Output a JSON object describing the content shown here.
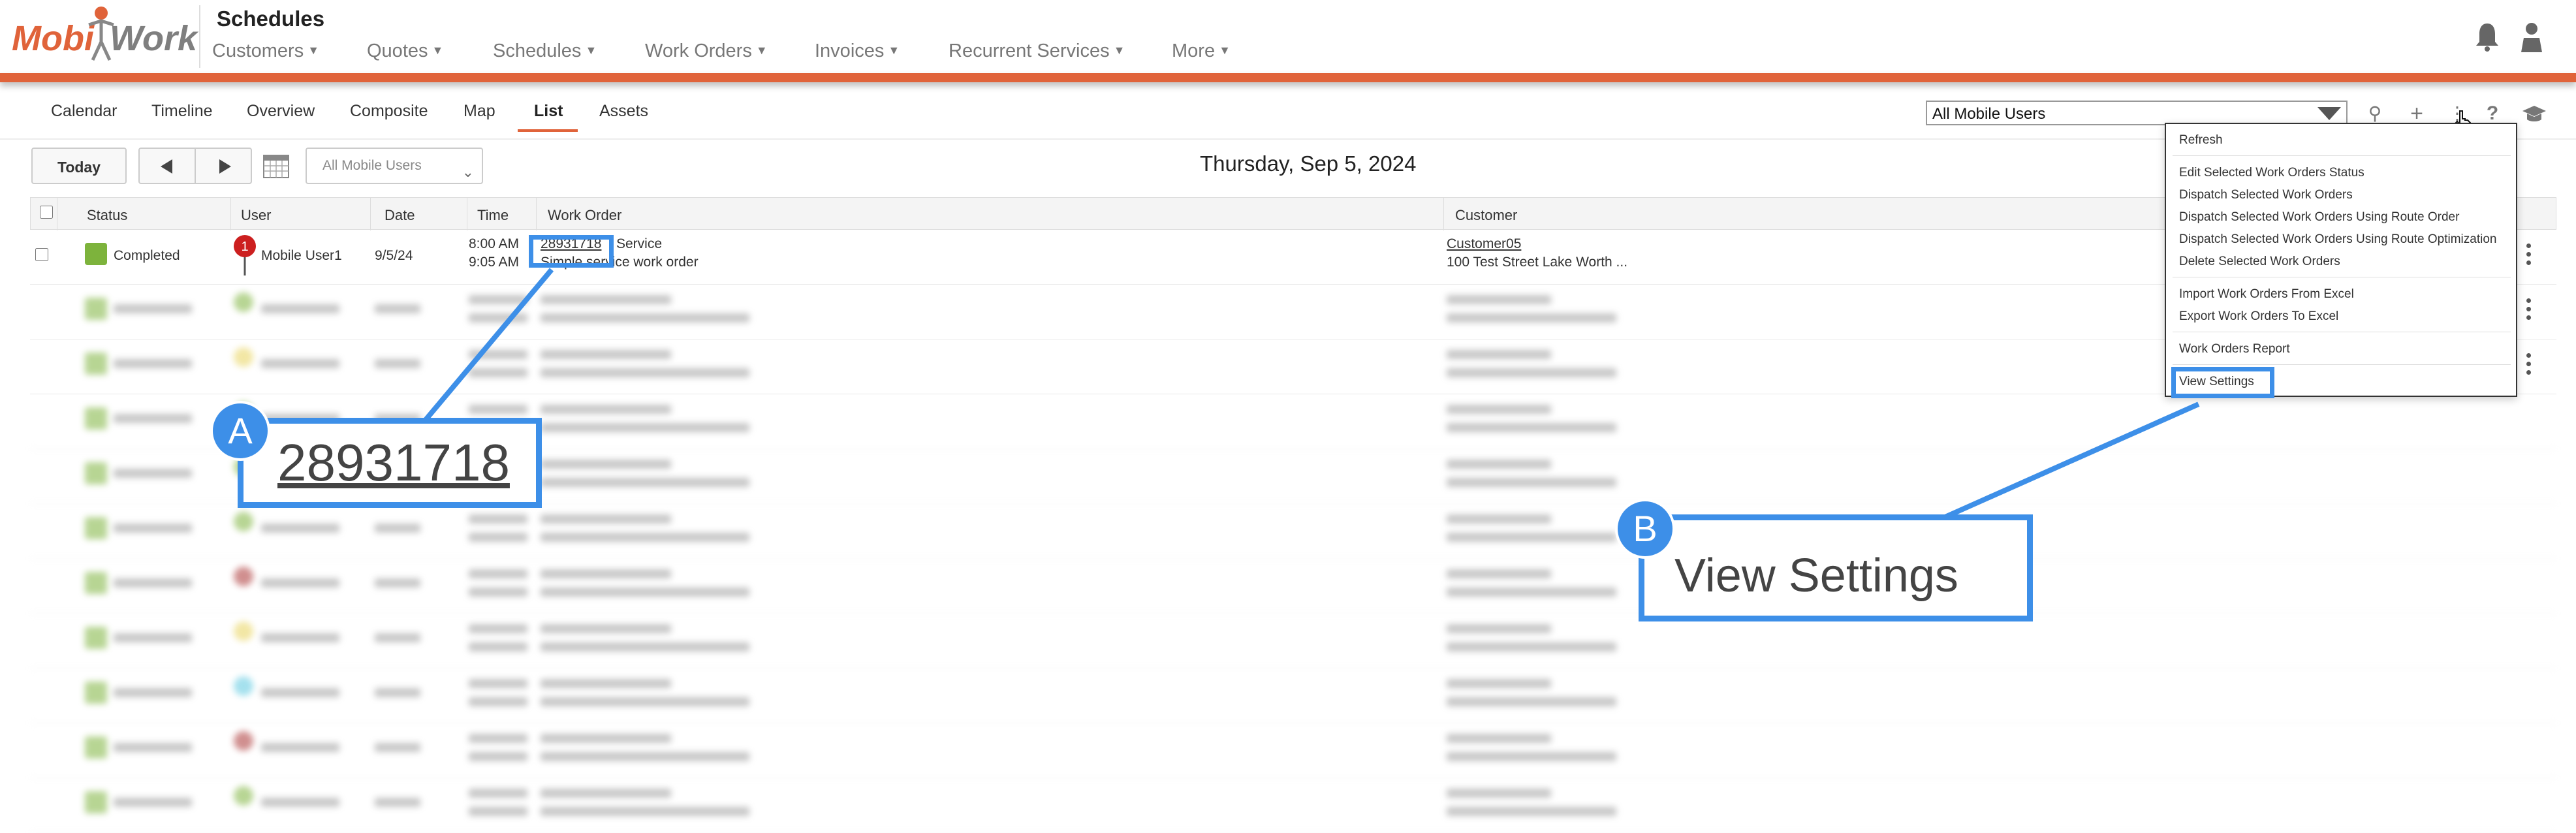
{
  "header": {
    "logo_text_left": "Mobi",
    "logo_text_right": "Work",
    "title": "Schedules",
    "nav": [
      "Customers",
      "Quotes",
      "Schedules",
      "Work Orders",
      "Invoices",
      "Recurrent Services",
      "More"
    ]
  },
  "tabs": [
    "Calendar",
    "Timeline",
    "Overview",
    "Composite",
    "Map",
    "List",
    "Assets"
  ],
  "active_tab": "List",
  "user_filter": "All Mobile Users",
  "toolbar": {
    "today_label": "Today",
    "users_dropdown": "All Mobile Users",
    "date_title": "Thursday, Sep 5, 2024"
  },
  "table": {
    "columns": [
      "Status",
      "User",
      "Date",
      "Time",
      "Work Order",
      "Customer"
    ],
    "row": {
      "status": "Completed",
      "user_pin_count": "1",
      "user": "Mobile User1",
      "date": "9/5/24",
      "time_start": "8:00 AM",
      "time_end": "9:05 AM",
      "work_order_id": "28931718",
      "work_order_type": "Service",
      "work_order_desc": "Simple service work order",
      "customer": "Customer05",
      "customer_address": "100 Test Street  Lake Worth ..."
    }
  },
  "menu": {
    "items": [
      "Refresh",
      "Edit Selected Work Orders Status",
      "Dispatch Selected Work Orders",
      "Dispatch Selected Work Orders Using Route Order",
      "Dispatch Selected Work Orders Using Route Optimization",
      "Delete Selected Work Orders",
      "Import Work Orders From Excel",
      "Export Work Orders To Excel",
      "Work Orders Report",
      "View Settings"
    ]
  },
  "callouts": {
    "a_badge": "A",
    "a_text": "28931718",
    "b_badge": "B",
    "b_text": "View Settings"
  },
  "colors": {
    "accent_orange": "#e0633a",
    "callout_blue": "#3d8fe8",
    "status_green": "#7db33c"
  }
}
